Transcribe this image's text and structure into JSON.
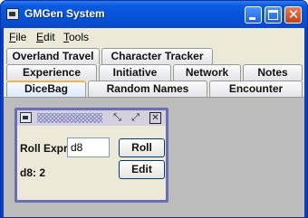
{
  "window": {
    "title": "GMGen System",
    "controls": {
      "minimize": "minimize",
      "maximize": "maximize",
      "close": "✕"
    }
  },
  "menubar": {
    "items": [
      {
        "mnemonic": "F",
        "rest": "ile"
      },
      {
        "mnemonic": "E",
        "rest": "dit"
      },
      {
        "mnemonic": "T",
        "rest": "ools"
      }
    ]
  },
  "tabs": {
    "row1": [
      "Overland Travel",
      "Character Tracker"
    ],
    "row2": [
      "Experience",
      "Initiative",
      "Network",
      "Notes"
    ],
    "row3": [
      "DiceBag",
      "Random Names",
      "Encounter"
    ],
    "selected": "DiceBag"
  },
  "dice_frame": {
    "roll_expr_label": "Roll Expr:",
    "roll_expr_value": "d8",
    "roll_button": "Roll",
    "edit_button": "Edit",
    "result": "d8: 2"
  },
  "colors": {
    "titlebar": "#0a5ae0",
    "internal_frame_border": "#6a6eb5",
    "desktop_background": "#bcbcbc",
    "selected_tab_accent": "#f1b64b"
  }
}
